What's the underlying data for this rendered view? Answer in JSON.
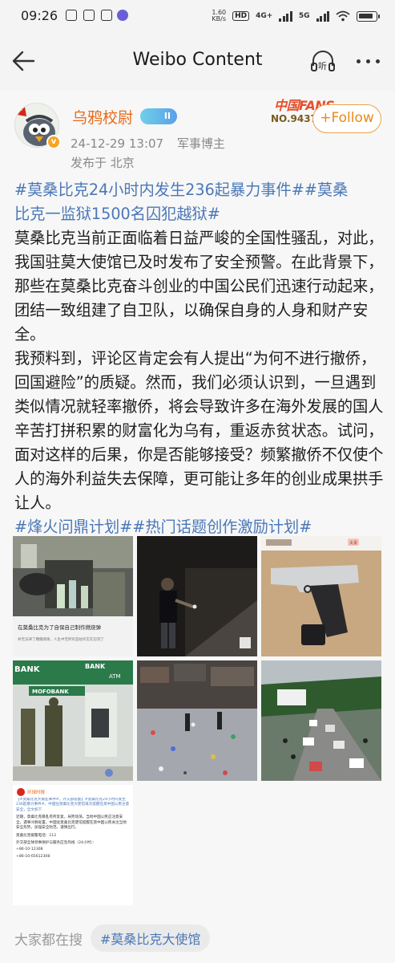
{
  "status_bar": {
    "time": "09:26",
    "speed_value": "1.60",
    "speed_unit": "KB/s",
    "hd_label": "HD",
    "network_1": "4G+",
    "network_2": "5G",
    "battery_icon": "battery-icon"
  },
  "nav": {
    "title": "Weibo Content",
    "back_icon": "arrow-left-icon",
    "listen_icon": "listen-icon",
    "more_icon": "more-dots-icon"
  },
  "author": {
    "name": "乌鸦校尉",
    "level_badge": "II",
    "timestamp": "24-12-29 13:07",
    "role": "军事博主",
    "location": "发布于 北京",
    "fans_title": "中国FANS",
    "fans_no": "NO.9437",
    "follow_label": "+Follow"
  },
  "post": {
    "tags_top_line1": "#莫桑比克24小时内发生236起暴力事件##莫桑",
    "tags_top_line2": "比克一监狱1500名囚犯越狱#",
    "paragraph_1": "莫桑比克当前正面临着日益严峻的全国性骚乱，对此，我国驻莫大使馆已及时发布了安全预警。在此背景下，那些在莫桑比克奋斗创业的中国公民们迅速行动起来，团结一致组建了自卫队，以确保自身的人身和财产安全。",
    "paragraph_2": "我预料到，评论区肯定会有人提出“为何不进行撤侨，回国避险”的质疑。然而，我们必须认识到，一旦遇到类似情况就轻率撤侨，将会导致许多在海外发展的国人辛苦打拼积累的财富化为乌有，重返赤贫状态。试问，面对这样的后果，你是否能够接受？频繁撤侨不仅使个人的海外利益失去保障，更可能让多年的创业成果拱手让人。",
    "tags_bottom": "#烽火问鼎计划##热门话题创作激励计划#"
  },
  "images": {
    "img1_caption": "在莫桑比克为了自保自己制作燃烧弹",
    "img1_sub": "并无法律了糟蹋情楽，人生中无所有是枕托实在忍到了",
    "img3_tag": "夫妻",
    "img4_sign": "BANK",
    "img4_sign2": "BANK",
    "img4_sign3": "ATM",
    "img4_sign4": "MOFOBANK",
    "img7_account": "环球时报",
    "img7_headline": "【#莫桑比克大暴乱事件#，外交部提醒】#莫桑比克24小时内发生236起暴力事件#，中国驻莫桑比克大使馆再次提醒在莫中国公民注意安全，全文如下",
    "img7_body": "近期，莫桑比克暴乱有所反复，局势动荡。当地中国公民应注意安全，遇事冷静处置。中国驻莫桑比克使馆提醒在莫中国公民关注当地安全形势，加强安全防范，谨慎出行。",
    "img7_line1": "莫桑比克报警电话：112",
    "img7_line2": "外交部全球领事保护与服务应急热线（24小时）：",
    "img7_line3": "+86-10-12308",
    "img7_line4": "+86-10-65612308"
  },
  "trending": {
    "label": "大家都在搜",
    "chip": "#莫桑比克大使馆"
  }
}
